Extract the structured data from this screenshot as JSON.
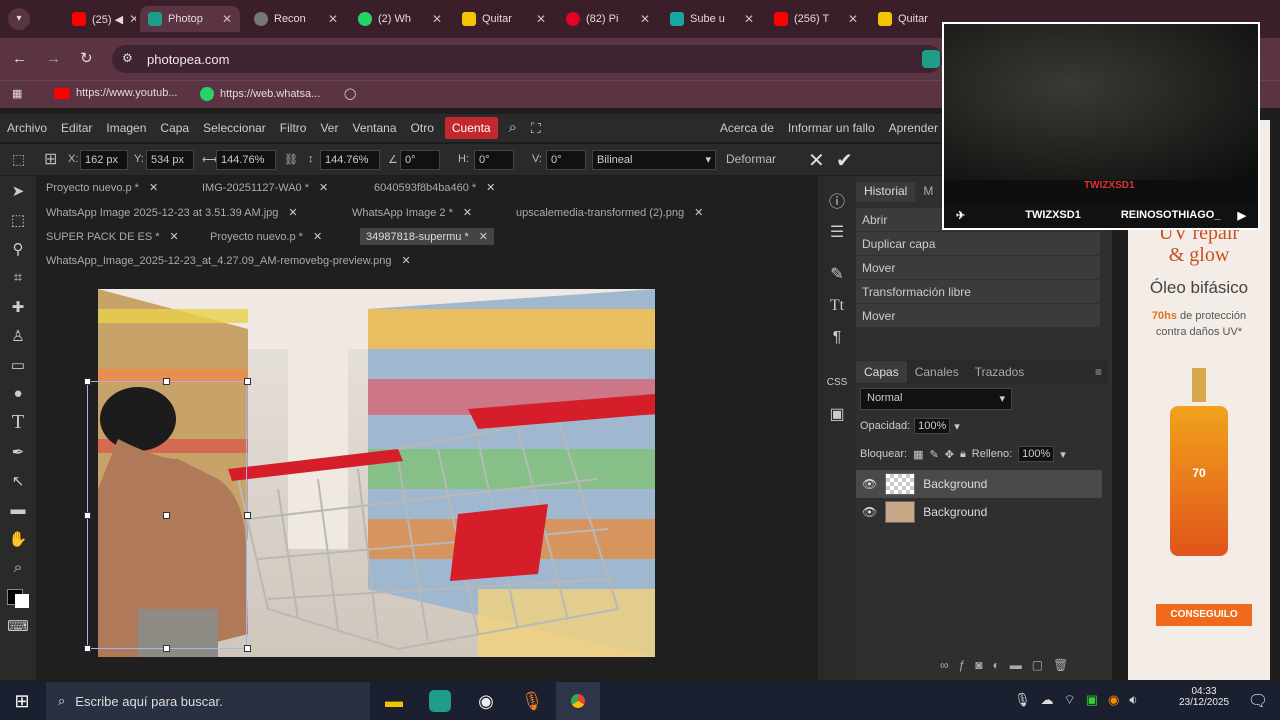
{
  "browser": {
    "tabs": [
      {
        "label": "(25) ◀",
        "color": "#ff0000",
        "active": false
      },
      {
        "label": "Photop",
        "color": "#1e9e8a",
        "active": true
      },
      {
        "label": "Recon",
        "color": "#888888",
        "active": false
      },
      {
        "label": "(2) Wh",
        "color": "#25d366",
        "active": false
      },
      {
        "label": "Quitar",
        "color": "#f4c400",
        "active": false
      },
      {
        "label": "(82) Pi",
        "color": "#e60023",
        "active": false
      },
      {
        "label": "Sube u",
        "color": "#1aa7a1",
        "active": false
      },
      {
        "label": "(256) T",
        "color": "#ff0000",
        "active": false
      },
      {
        "label": "Quitar",
        "color": "#f4c400",
        "active": false
      }
    ],
    "url": "photopea.com",
    "bookmarks": [
      {
        "label": "https://www.youtub...",
        "icon": "youtube-icon"
      },
      {
        "label": "https://web.whatsa...",
        "icon": "whatsapp-icon"
      }
    ]
  },
  "menu": [
    "Archivo",
    "Editar",
    "Imagen",
    "Capa",
    "Seleccionar",
    "Filtro",
    "Ver",
    "Ventana",
    "Otro",
    "Cuenta"
  ],
  "menu_right": [
    "Acerca de",
    "Informar un fallo",
    "Aprender"
  ],
  "options": {
    "x_label": "X:",
    "x": "162 px",
    "y_label": "Y:",
    "y": "534 px",
    "w": "144.76%",
    "h": "144.76%",
    "angle": "0°",
    "hskew_label": "H:",
    "hskew": "0°",
    "vskew_label": "V:",
    "vskew": "0°",
    "interp": "Bilineal",
    "deform": "Deformar"
  },
  "docs": {
    "row1": [
      "Proyecto nuevo.p",
      "IMG-20251127-WA0",
      "6040593f8b4ba460"
    ],
    "row2": [
      "WhatsApp Image 2025-12-23 at 3.51.39 AM.jpg",
      "WhatsApp Image 2",
      "upscalemedia-transformed (2).png"
    ],
    "row3": [
      "SUPER PACK DE ES",
      "Proyecto nuevo.p",
      "34987818-supermu"
    ],
    "row4": [
      "WhatsApp_Image_2025-12-23_at_4.27.09_AM-removebg-preview.png"
    ]
  },
  "history": {
    "tabs": [
      "Historial",
      "M"
    ],
    "items": [
      "Abrir",
      "Duplicar capa",
      "Mover",
      "Transformación libre",
      "Mover"
    ]
  },
  "layers": {
    "tabs": [
      "Capas",
      "Canales",
      "Trazados"
    ],
    "blend": "Normal",
    "opacity_label": "Opacidad:",
    "opacity": "100%",
    "lock_label": "Bloquear:",
    "fill_label": "Relleno:",
    "fill": "100%",
    "items": [
      "Background",
      "Background"
    ]
  },
  "ad": {
    "headline1": "UV repair",
    "headline2": "& glow",
    "product": "Óleo bifásico",
    "hours": "70hs",
    "claim1": "de protección",
    "claim2": "contra daños UV*",
    "bottle": "70",
    "cta": "CONSEGUILO"
  },
  "webcam": {
    "name": "TWIZXSD1",
    "handle": "TWIZXSD1",
    "other": "REINOSOTHIAGO_"
  },
  "taskbar": {
    "search_placeholder": "Escribe aquí para buscar.",
    "time": "04:33",
    "date": "23/12/2025"
  }
}
